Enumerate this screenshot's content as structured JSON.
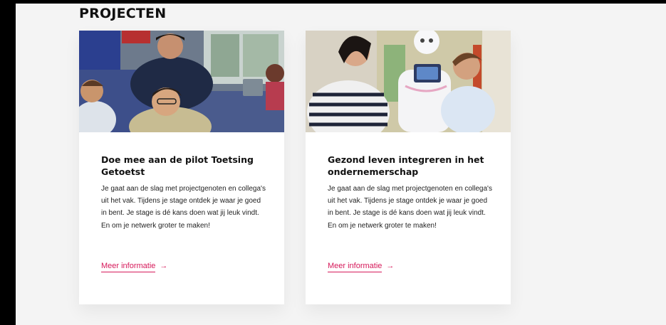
{
  "section": {
    "title": "PROJECTEN"
  },
  "cards": [
    {
      "title": "Doe mee aan de pilot Toetsing Getoetst",
      "description": "Je gaat aan de slag met projectgenoten en collega's uit het vak. Tijdens je stage ontdek je waar je goed in bent. Je stage is dé kans doen wat jij leuk vindt. En om je netwerk groter te maken!",
      "link": "Meer informatie",
      "link_icon": "arrow-right-icon"
    },
    {
      "title": "Gezond leven integreren in het ondernemerschap",
      "description": "Je gaat aan de slag met projectgenoten en collega's uit het vak. Tijdens je stage ontdek je waar je goed in bent. Je stage is dé kans doen wat jij leuk vindt. En om je netwerk groter te maken!",
      "link": "Meer informatie",
      "link_icon": "arrow-right-icon"
    }
  ],
  "colors": {
    "accent": "#d6195a",
    "page_background": "#f4f4f4",
    "card_background": "#ffffff",
    "text": "#111111"
  }
}
